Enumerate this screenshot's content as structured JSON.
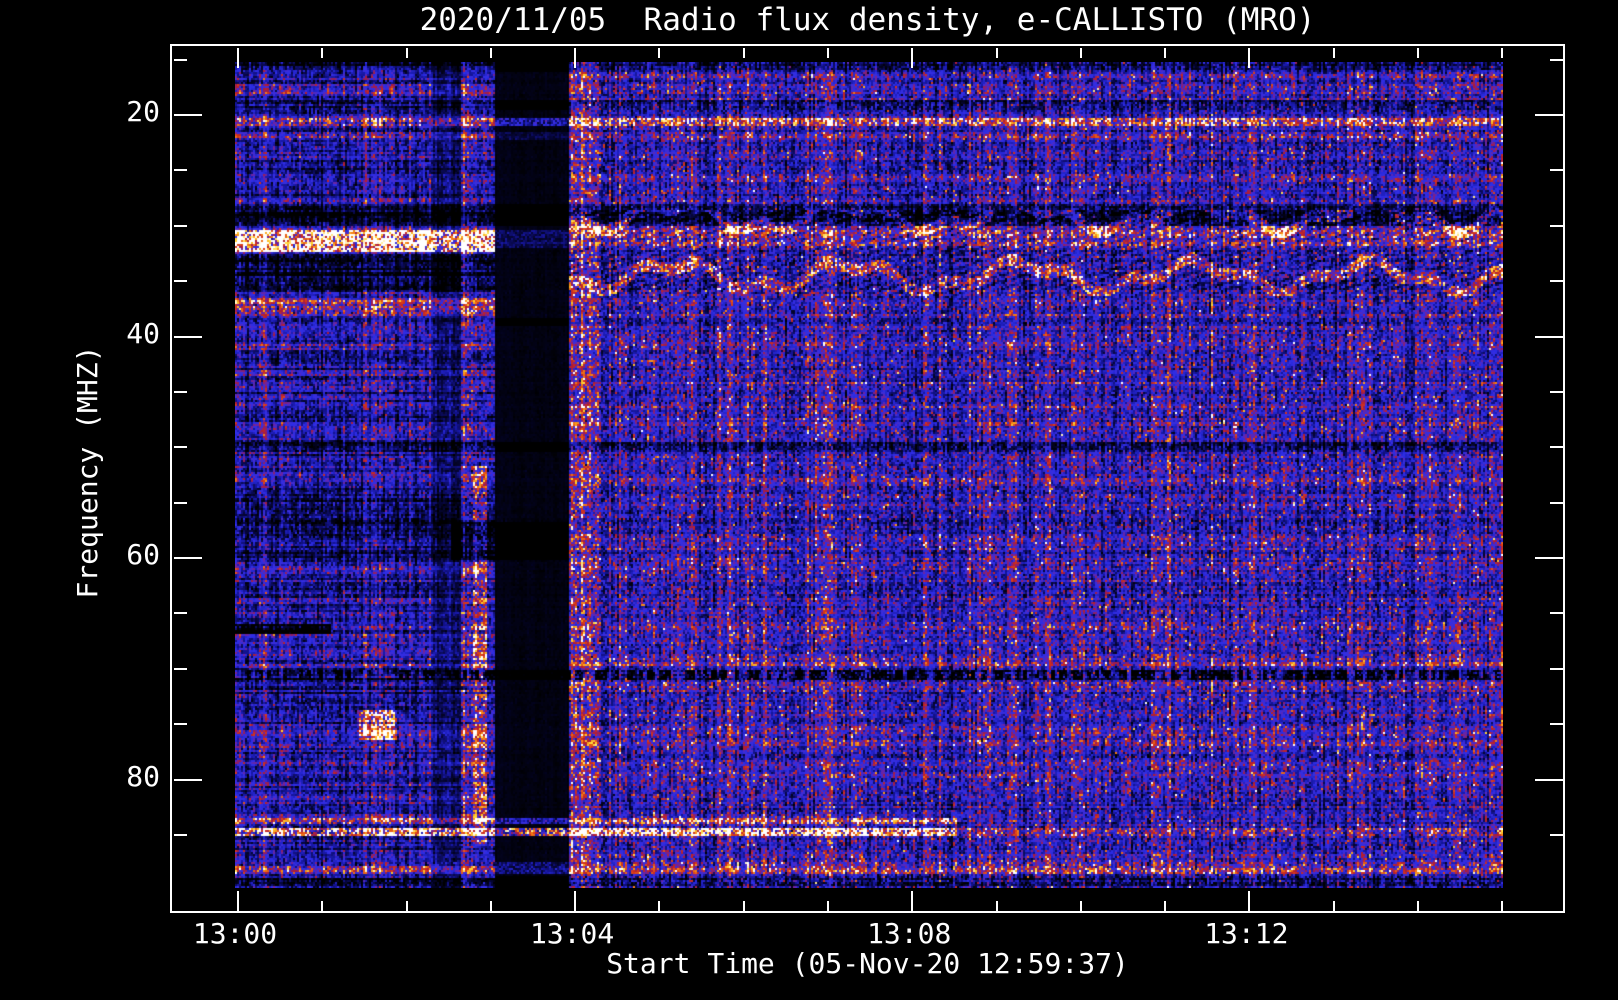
{
  "chart_data": {
    "type": "heatmap",
    "title": "2020/11/05  Radio flux density, e-CALLISTO (MRO)",
    "xlabel": "Start Time (05-Nov-20 12:59:37)",
    "ylabel": "Frequency (MHZ)",
    "x_tick_labels": [
      "13:00",
      "13:04",
      "13:08",
      "13:12"
    ],
    "x_minor_tick_interval": "1 min",
    "y_tick_labels": [
      "20",
      "40",
      "60",
      "80"
    ],
    "y_minor_tick_interval_mhz": 5,
    "x_range": [
      "12:59:37",
      "13:15:05"
    ],
    "y_range_mhz": [
      15.5,
      90.0
    ],
    "y_axis_inverted": true,
    "background": "#000000",
    "foreground": "#ffffff",
    "legend": "none",
    "grid": "off",
    "colormap_stops": [
      [
        0.0,
        "#000000"
      ],
      [
        0.18,
        "#06063c"
      ],
      [
        0.34,
        "#1616a0"
      ],
      [
        0.48,
        "#2d2de6"
      ],
      [
        0.56,
        "#3c2dd8"
      ],
      [
        0.62,
        "#6e23a0"
      ],
      [
        0.7,
        "#af1c32"
      ],
      [
        0.78,
        "#d73719"
      ],
      [
        0.86,
        "#f58214"
      ],
      [
        0.93,
        "#ffd732"
      ],
      [
        1.0,
        "#ffffff"
      ]
    ],
    "features": {
      "noise": {
        "base": 0.44,
        "col": 0.16,
        "col2": 0.06,
        "row": 0.09,
        "row2": 0.05,
        "pix": 0.3,
        "left_extra_row": 0.14,
        "left_mul": 0.95,
        "left_dv": -0.02,
        "right_dv": 0.015,
        "red_prob": 0.08,
        "red_dv": 0.22,
        "u_left": 0.205
      },
      "v_bands": [
        {
          "u": [
            0.154,
            0.178
          ],
          "mul": 0.6
        },
        {
          "u": [
            0.179,
            0.188
          ],
          "dv": 0.2,
          "sp": 1
        },
        {
          "u": [
            0.188,
            0.199
          ],
          "dv": 0.28,
          "f": [
            52,
            86
          ],
          "sp": 1
        },
        {
          "u": [
            0.205,
            0.263
          ],
          "mul": 0.12
        },
        {
          "u": [
            0.263,
            0.288
          ],
          "dv": 0.18,
          "sp": 1
        }
      ],
      "h_bands": [
        {
          "f": [
            15.5,
            16.4
          ],
          "dv": -0.2
        },
        {
          "f": [
            19.0,
            19.9
          ],
          "dv": -0.2
        },
        {
          "f": [
            20.6,
            21.3
          ],
          "dv": 0.32,
          "sp": 1
        },
        {
          "f": [
            21.9,
            22.5
          ],
          "dv": 0.12,
          "sp": 1
        },
        {
          "f": [
            28.3,
            30.3
          ],
          "dv": -0.3
        },
        {
          "f": [
            30.6,
            32.6
          ],
          "dv": 0.6,
          "sp": 1,
          "u": [
            0.0,
            0.205
          ]
        },
        {
          "f": [
            30.6,
            32.2
          ],
          "dv": 0.16,
          "sp": 1,
          "u": [
            0.205,
            1.0
          ]
        },
        {
          "f": [
            32.9,
            36.2
          ],
          "dv": -0.27,
          "u": [
            0.0,
            0.205
          ]
        },
        {
          "f": [
            36.8,
            38.2
          ],
          "dv": 0.26,
          "sp": 1,
          "u": [
            0.0,
            0.205
          ]
        },
        {
          "f": [
            38.5,
            39.3
          ],
          "dv": -0.15
        },
        {
          "f": [
            49.8,
            50.6
          ],
          "dv": -0.25
        },
        {
          "f": [
            54.5,
            60.5
          ],
          "dv": -0.15,
          "u": [
            0.0,
            0.205
          ]
        },
        {
          "f": [
            57.0,
            60.5
          ],
          "dv": -0.3,
          "u": [
            0.17,
            0.263
          ]
        },
        {
          "f": [
            66.2,
            67.1
          ],
          "dv": -0.5,
          "u": [
            0.0,
            0.075
          ]
        },
        {
          "f": [
            69.0,
            70.0
          ],
          "dv": 0.12,
          "sp": 1,
          "u": [
            0.263,
            1.0
          ]
        },
        {
          "f": [
            70.3,
            71.2
          ],
          "dv": -0.42,
          "sp": 1,
          "dash": 1
        },
        {
          "f": [
            71.5,
            72.4
          ],
          "dv": 0.12,
          "sp": 1,
          "u": [
            0.263,
            1.0
          ]
        },
        {
          "f": [
            74.0,
            76.6
          ],
          "dv": 0.42,
          "sp": 1,
          "u": [
            0.098,
            0.128
          ]
        },
        {
          "f": [
            83.6,
            84.2
          ],
          "dv": 0.34,
          "sp": 1,
          "u": [
            0.0,
            0.57
          ]
        },
        {
          "f": [
            84.5,
            85.3
          ],
          "dv": 0.58,
          "sp": 1,
          "u": [
            0.0,
            0.57
          ]
        },
        {
          "f": [
            84.5,
            85.3
          ],
          "dv": 0.22,
          "sp": 1,
          "u": [
            0.57,
            1.0
          ]
        },
        {
          "f": [
            87.6,
            88.8
          ],
          "dv": 0.22,
          "sp": 1
        },
        {
          "f": [
            89.0,
            90.0
          ],
          "dv": -0.2,
          "sp": 1
        }
      ],
      "wavy": {
        "u0": 0.263,
        "lines": [
          29.4,
          34.8
        ],
        "amp": 1.1,
        "amp2": 0.5,
        "w": 0.55,
        "dv": 0.3,
        "hatch": 0.1,
        "hatch_f": [
          28.8,
          36.6
        ],
        "dark": 0.04
      }
    },
    "notes": [
      "Solar radio spectrogram, blue noise background with red speckle",
      "Narrowband RFI line near 21 MHz across full duration",
      "Bright orange-yellow emission band 30.5-32.5 MHz before 13:04, wavy red interference 29-35 MHz after 13:04",
      "Instrument/data gap appears as black vertical band ~13:03:10-13:04:00 preceded by dark column and red column",
      "Dashed dark absorption line near 70.7 MHz across full duration",
      "Strong yellow RFI line near 84.8 MHz until ~13:08, red band near 88 MHz",
      "Red blob near 75 MHz around 13:01:30"
    ]
  }
}
